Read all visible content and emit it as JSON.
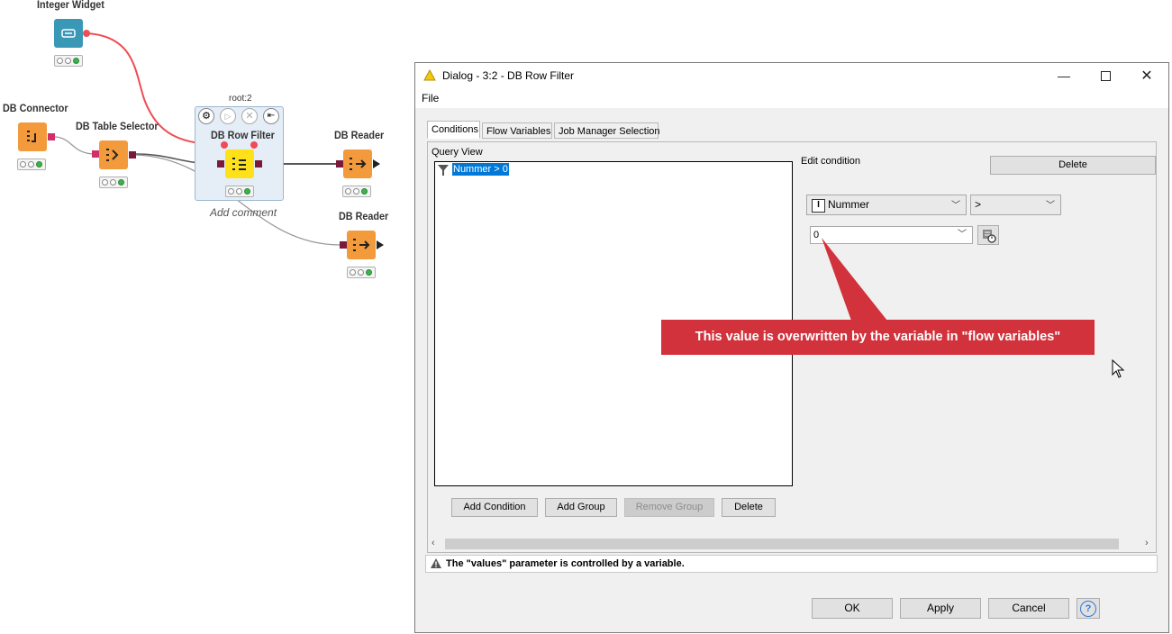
{
  "workflow": {
    "nodes": {
      "integer_widget": {
        "label": "Integer Widget"
      },
      "db_connector": {
        "label": "DB Connector"
      },
      "db_table_selector": {
        "label": "DB Table Selector"
      },
      "db_row_filter": {
        "label": "DB Row Filter",
        "component_label": "root:2",
        "comment": "Add comment"
      },
      "db_reader_1": {
        "label": "DB Reader"
      },
      "db_reader_2": {
        "label": "DB Reader"
      }
    },
    "colors": {
      "db_node": "#f39a3c",
      "widget_node": "#3a98b7",
      "selected_node": "#ffe11a",
      "flow_variable_line": "#ef4c55"
    }
  },
  "dialog": {
    "title": "Dialog - 3:2 - DB Row Filter",
    "menu": {
      "file": "File"
    },
    "tabs": [
      {
        "label": "Conditions"
      },
      {
        "label": "Flow Variables"
      },
      {
        "label": "Job Manager Selection"
      }
    ],
    "query_view": {
      "label": "Query View",
      "items": [
        {
          "text": "Nummer > 0"
        }
      ]
    },
    "buttons": {
      "add_condition": "Add Condition",
      "add_group": "Add Group",
      "remove_group": "Remove Group",
      "delete": "Delete"
    },
    "edit_condition": {
      "label": "Edit condition",
      "delete_label": "Delete",
      "column": "Nummer",
      "column_type_badge": "I",
      "operator": ">",
      "value": "0"
    },
    "info_message": "The \"values\" parameter is controlled by a variable.",
    "footer": {
      "ok": "OK",
      "apply": "Apply",
      "cancel": "Cancel",
      "help": "?"
    }
  },
  "callout": {
    "text": "This value is overwritten by the variable in \"flow variables\"",
    "color": "#d2323c"
  }
}
